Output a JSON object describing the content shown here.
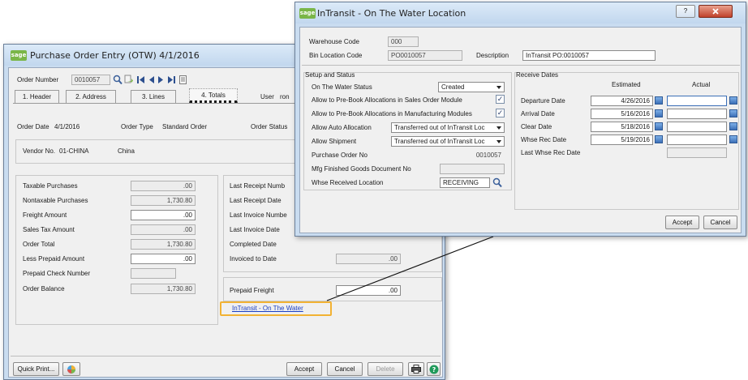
{
  "po_window": {
    "title": "Purchase Order Entry (OTW) 4/1/2016",
    "order_number_label": "Order Number",
    "order_number": "0010057",
    "tabs": [
      {
        "label": "1. Header"
      },
      {
        "label": "2. Address"
      },
      {
        "label": "3. Lines"
      },
      {
        "label": "4. Totals"
      }
    ],
    "user_label": "User",
    "user_value": "ron",
    "order_date_label": "Order Date",
    "order_date": "4/1/2016",
    "order_type_label": "Order Type",
    "order_type": "Standard Order",
    "order_status_label": "Order Status",
    "vendor_no_label": "Vendor No.",
    "vendor_no": "01-CHINA",
    "vendor_name": "China",
    "totals": [
      {
        "label": "Taxable Purchases",
        "value": ".00"
      },
      {
        "label": "Nontaxable Purchases",
        "value": "1,730.80"
      },
      {
        "label": "Freight Amount",
        "value": ".00"
      },
      {
        "label": "Sales Tax Amount",
        "value": ".00"
      },
      {
        "label": "Order Total",
        "value": "1,730.80"
      },
      {
        "label": "Less Prepaid Amount",
        "value": ".00"
      },
      {
        "label": "Prepaid Check Number",
        "value": ""
      },
      {
        "label": "Order Balance",
        "value": "1,730.80"
      }
    ],
    "right_labels": [
      {
        "label": "Last Receipt Numb"
      },
      {
        "label": "Last Receipt Date"
      },
      {
        "label": "Last Invoice Numbe"
      },
      {
        "label": "Last Invoice Date"
      },
      {
        "label": "Completed Date"
      },
      {
        "label": "Invoiced to Date",
        "value": ".00"
      }
    ],
    "prepaid_freight_label": "Prepaid Freight",
    "prepaid_freight": ".00",
    "intransit_link": "InTransit - On The Water",
    "buttons": {
      "quick_print": "Quick Print...",
      "accept": "Accept",
      "cancel": "Cancel",
      "delete": "Delete"
    }
  },
  "otw_window": {
    "title": "InTransit - On The Water Location",
    "warehouse_code_label": "Warehouse Code",
    "warehouse_code": "000",
    "bin_location_label": "Bin Location Code",
    "bin_location": "PO0010057",
    "description_label": "Description",
    "description": "InTransit PO:0010057",
    "setup_title": "Setup and Status",
    "otw_status_label": "On The Water Status",
    "otw_status": "Created",
    "prebook_so_label": "Allow to Pre-Book Allocations in Sales Order Module",
    "prebook_mfg_label": "Allow to Pre-Book Allocations in Manufacturing Modules",
    "auto_alloc_label": "Allow Auto Allocation",
    "auto_alloc": "Transferred out of InTransit Loc",
    "allow_shipment_label": "Allow Shipment",
    "allow_shipment": "Transferred out of InTransit Loc",
    "po_no_label": "Purchase Order No",
    "po_no": "0010057",
    "mfg_doc_label": "Mfg Finished Goods Document No",
    "whse_received_label": "Whse Received Location",
    "whse_received": "RECEIVING",
    "receive_dates_title": "Receive Dates",
    "estimated_header": "Estimated",
    "actual_header": "Actual",
    "dates": [
      {
        "label": "Departure Date",
        "estimated": "4/26/2016",
        "actual": ""
      },
      {
        "label": "Arrival Date",
        "estimated": "5/16/2016",
        "actual": ""
      },
      {
        "label": "Clear Date",
        "estimated": "5/18/2016",
        "actual": ""
      },
      {
        "label": "Whse Rec Date",
        "estimated": "5/19/2016",
        "actual": ""
      },
      {
        "label": "Last Whse Rec Date",
        "estimated": "",
        "actual": ""
      }
    ],
    "buttons": {
      "accept": "Accept",
      "cancel": "Cancel",
      "help": "?"
    }
  }
}
